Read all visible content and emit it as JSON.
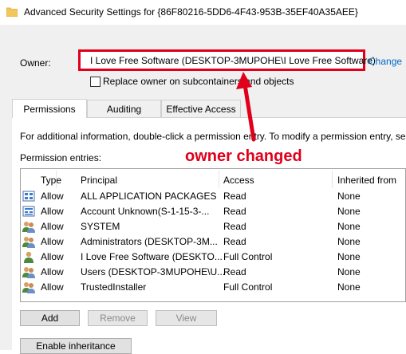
{
  "window": {
    "title": "Advanced Security Settings for {86F80216-5DD6-4F43-953B-35EF40A35AEE}"
  },
  "owner": {
    "label": "Owner:",
    "value": "I Love Free Software (DESKTOP-3MUPOHE\\I Love Free Software)",
    "change_link": "Change"
  },
  "replace_owner": {
    "label": "Replace owner on subcontainers and objects",
    "checked": false
  },
  "tabs": [
    {
      "label": "Permissions",
      "active": true
    },
    {
      "label": "Auditing",
      "active": false
    },
    {
      "label": "Effective Access",
      "active": false
    }
  ],
  "permissions": {
    "info_text": "For additional information, double-click a permission entry. To modify a permission entry, se",
    "entries_label": "Permission entries:",
    "columns": [
      "Type",
      "Principal",
      "Access",
      "Inherited from"
    ],
    "rows": [
      {
        "icon": "app-packages-icon",
        "type": "Allow",
        "principal": "ALL APPLICATION PACKAGES",
        "access": "Read",
        "inherited": "None"
      },
      {
        "icon": "unknown-account-icon",
        "type": "Allow",
        "principal": "Account Unknown(S-1-15-3-...",
        "access": "Read",
        "inherited": "None"
      },
      {
        "icon": "group-icon",
        "type": "Allow",
        "principal": "SYSTEM",
        "access": "Read",
        "inherited": "None"
      },
      {
        "icon": "group-icon",
        "type": "Allow",
        "principal": "Administrators (DESKTOP-3M...",
        "access": "Read",
        "inherited": "None"
      },
      {
        "icon": "user-icon",
        "type": "Allow",
        "principal": "I Love Free Software (DESKTO...",
        "access": "Full Control",
        "inherited": "None"
      },
      {
        "icon": "group-icon",
        "type": "Allow",
        "principal": "Users (DESKTOP-3MUPOHE\\U...",
        "access": "Read",
        "inherited": "None"
      },
      {
        "icon": "group-icon",
        "type": "Allow",
        "principal": "TrustedInstaller",
        "access": "Full Control",
        "inherited": "None"
      }
    ]
  },
  "buttons": {
    "add": "Add",
    "remove": "Remove",
    "view": "View",
    "enable_inheritance": "Enable inheritance"
  },
  "annotation": {
    "text": "owner changed",
    "color": "#e0001b"
  }
}
